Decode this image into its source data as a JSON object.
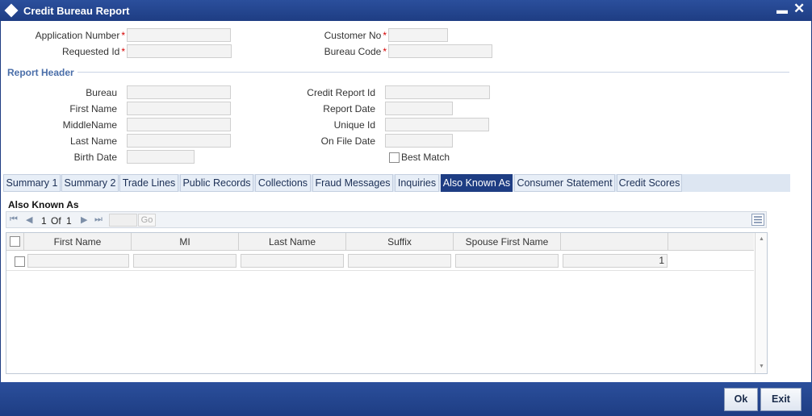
{
  "window": {
    "title": "Credit Bureau Report",
    "minimize_glyph": "▬",
    "close_glyph": "✕"
  },
  "top_fields": {
    "application_number_label": "Application Number",
    "requested_id_label": "Requested Id",
    "customer_no_label": "Customer No",
    "bureau_code_label": "Bureau Code",
    "required_mark": "*"
  },
  "report_header": {
    "title": "Report Header",
    "bureau_label": "Bureau",
    "first_name_label": "First Name",
    "middle_name_label": "MiddleName",
    "last_name_label": "Last Name",
    "birth_date_label": "Birth Date",
    "credit_report_id_label": "Credit Report Id",
    "report_date_label": "Report Date",
    "unique_id_label": "Unique Id",
    "on_file_date_label": "On File Date",
    "best_match_label": "Best Match"
  },
  "tabs": [
    {
      "label": "Summary 1"
    },
    {
      "label": "Summary 2"
    },
    {
      "label": "Trade Lines"
    },
    {
      "label": "Public Records"
    },
    {
      "label": "Collections"
    },
    {
      "label": "Fraud Messages"
    },
    {
      "label": "Inquiries"
    },
    {
      "label": "Also Known As"
    },
    {
      "label": "Consumer Statement"
    },
    {
      "label": "Credit Scores"
    }
  ],
  "active_tab": "Also Known As",
  "grid_section": {
    "title": "Also Known As",
    "pager": {
      "first_glyph": "⏮",
      "prev_glyph": "◀",
      "next_glyph": "▶",
      "last_glyph": "⏭",
      "page": "1",
      "of_label": "Of",
      "total": "1",
      "go_label": "Go"
    },
    "columns": [
      "First Name",
      "MI",
      "Last Name",
      "Suffix",
      "Spouse First Name",
      ""
    ],
    "rows": [
      {
        "cells": [
          "",
          "",
          "",
          "",
          "",
          "1"
        ]
      }
    ]
  },
  "footer": {
    "ok_label": "Ok",
    "exit_label": "Exit"
  },
  "colors": {
    "titlebar": "#1e3d83",
    "active_tab": "#1e3d83",
    "section_title": "#4a6ea9",
    "required": "#d40000"
  }
}
